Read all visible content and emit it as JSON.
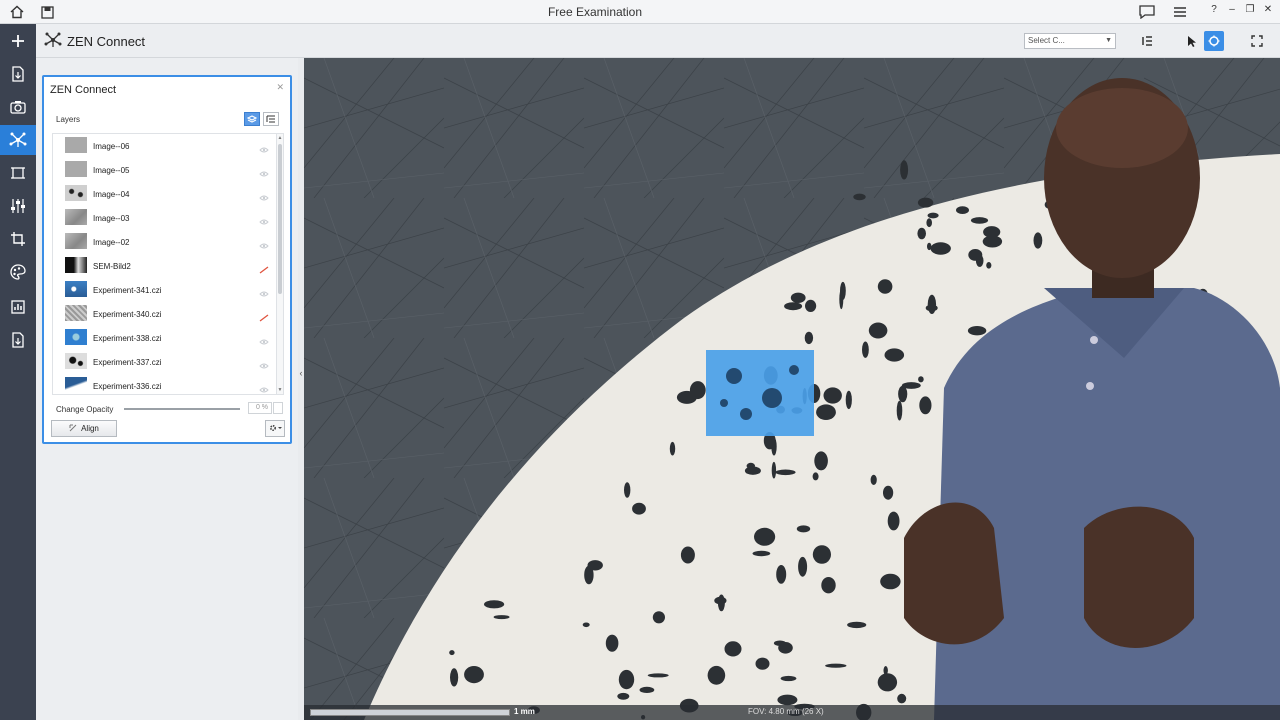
{
  "window": {
    "title": "Free Examination"
  },
  "module": {
    "title": "ZEN Connect",
    "select_placeholder": "Select C..."
  },
  "panel": {
    "title": "ZEN Connect",
    "layers_label": "Layers",
    "layers": [
      {
        "name": "Image--06",
        "thumb": "gray-flat",
        "visibility": "hidden"
      },
      {
        "name": "Image--05",
        "thumb": "gray-flat",
        "visibility": "hidden"
      },
      {
        "name": "Image--04",
        "thumb": "dots",
        "visibility": "hidden"
      },
      {
        "name": "Image--03",
        "thumb": "gray-texture",
        "visibility": "hidden"
      },
      {
        "name": "Image--02",
        "thumb": "gray-texture",
        "visibility": "hidden"
      },
      {
        "name": "SEM-Bild2",
        "thumb": "sem-dark",
        "visibility": "disabled"
      },
      {
        "name": "Experiment-341.czi",
        "thumb": "blue-dots",
        "visibility": "hidden"
      },
      {
        "name": "Experiment-340.czi",
        "thumb": "gray-noise",
        "visibility": "disabled"
      },
      {
        "name": "Experiment-338.czi",
        "thumb": "blue-solid",
        "visibility": "hidden"
      },
      {
        "name": "Experiment-337.czi",
        "thumb": "dark-dots",
        "visibility": "hidden"
      },
      {
        "name": "Experiment-336.czi",
        "thumb": "blue-white",
        "visibility": "hidden"
      }
    ],
    "opacity_label": "Change Opacity",
    "opacity_value": "0 %",
    "align_label": "Align"
  },
  "viewer": {
    "scale_label": "1 mm",
    "fov_label": "FOV: 4.80 mm (26 X)"
  },
  "colors": {
    "accent": "#2a7fd9",
    "toolbar_bg": "#3b4250",
    "disabled_eye": "#e0533e"
  }
}
